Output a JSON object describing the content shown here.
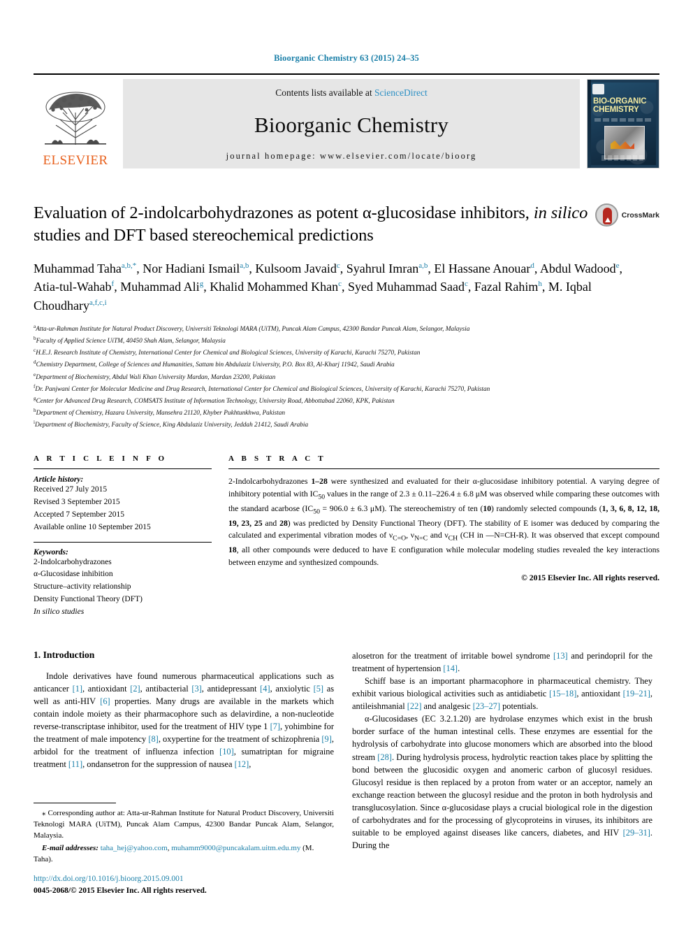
{
  "running_head": "Bioorganic Chemistry 63 (2015) 24–35",
  "masthead": {
    "contents_prefix": "Contents lists available at ",
    "sciencedirect": "ScienceDirect",
    "journal_name": "Bioorganic Chemistry",
    "homepage": "journal homepage: www.elsevier.com/locate/bioorg",
    "publisher_logo_text": "ELSEVIER",
    "cover": {
      "title_line1": "BIO-ORGANIC",
      "title_line2": "CHEMISTRY"
    },
    "accent_link_color": "#2b8fc4"
  },
  "title": {
    "part1": "Evaluation of 2-indolcarbohydrazones as potent α-glucosidase inhibitors, ",
    "italic": "in silico",
    "part2": " studies and DFT based stereochemical predictions"
  },
  "crossmark": {
    "label": "CrossMark"
  },
  "authors": [
    {
      "name": "Muhammad Taha",
      "sup": "a,b,*",
      "sep": ", "
    },
    {
      "name": "Nor Hadiani Ismail",
      "sup": "a,b",
      "sep": ", "
    },
    {
      "name": "Kulsoom Javaid",
      "sup": "c",
      "sep": ", "
    },
    {
      "name": "Syahrul Imran",
      "sup": "a,b",
      "sep": ", "
    },
    {
      "name": "El Hassane Anouar",
      "sup": "d",
      "sep": ", "
    },
    {
      "name": "Abdul Wadood",
      "sup": "e",
      "sep": ", "
    },
    {
      "name": "Atia-tul-Wahab",
      "sup": "f",
      "sep": ", "
    },
    {
      "name": "Muhammad Ali",
      "sup": "g",
      "sep": ", "
    },
    {
      "name": "Khalid Mohammed Khan",
      "sup": "c",
      "sep": ", "
    },
    {
      "name": "Syed Muhammad Saad",
      "sup": "c",
      "sep": ", "
    },
    {
      "name": "Fazal Rahim",
      "sup": "h",
      "sep": ", "
    },
    {
      "name": "M. Iqbal Choudhary",
      "sup": "a,f,c,i",
      "sep": ""
    }
  ],
  "affiliations": [
    {
      "mark": "a",
      "text": "Atta-ur-Rahman Institute for Natural Product Discovery, Universiti Teknologi MARA (UiTM), Puncak Alam Campus, 42300 Bandar Puncak Alam, Selangor, Malaysia"
    },
    {
      "mark": "b",
      "text": "Faculty of Applied Science UiTM, 40450 Shah Alam, Selangor, Malaysia"
    },
    {
      "mark": "c",
      "text": "H.E.J. Research Institute of Chemistry, International Center for Chemical and Biological Sciences, University of Karachi, Karachi 75270, Pakistan"
    },
    {
      "mark": "d",
      "text": "Chemistry Department, College of Sciences and Humanities, Sattam bin Abdulaziz University, P.O. Box 83, Al-Kharj 11942, Saudi Arabia"
    },
    {
      "mark": "e",
      "text": "Department of Biochemistry, Abdul Wali Khan University Mardan, Mardan 23200, Pakistan"
    },
    {
      "mark": "f",
      "text": "Dr. Panjwani Center for Molecular Medicine and Drug Research, International Center for Chemical and Biological Sciences, University of Karachi, Karachi 75270, Pakistan"
    },
    {
      "mark": "g",
      "text": "Center for Advanced Drug Research, COMSATS Institute of Information Technology, University Road, Abbottabad 22060, KPK, Pakistan"
    },
    {
      "mark": "h",
      "text": "Department of Chemistry, Hazara University, Mansehra 21120, Khyber Pukhtunkhwa, Pakistan"
    },
    {
      "mark": "i",
      "text": "Department of Biochemistry, Faculty of Science, King Abdulaziz University, Jeddah 21412, Saudi Arabia"
    }
  ],
  "article_info": {
    "heading": "A R T I C L E   I N F O",
    "history_label": "Article history:",
    "history": [
      "Received 27 July 2015",
      "Revised 3 September 2015",
      "Accepted 7 September 2015",
      "Available online 10 September 2015"
    ],
    "keywords_label": "Keywords:",
    "keywords": [
      "2-Indolcarbohydrazones",
      "α-Glucosidase inhibition",
      "Structure–activity relationship",
      "Density Functional Theory (DFT)",
      "In silico studies"
    ]
  },
  "abstract": {
    "heading": "A B S T R A C T",
    "s1": "2-Indolcarbohydrazones ",
    "b1": "1–28",
    "s2": " were synthesized and evaluated for their α-glucosidase inhibitory potential. A varying degree of inhibitory potential with IC",
    "sub1": "50",
    "s3": " values in the range of 2.3 ± 0.11–226.4 ± 6.8 μM was observed while comparing these outcomes with the standard acarbose (IC",
    "sub2": "50",
    "s4": " = 906.0 ± 6.3 μM). The stereochemistry of ten (",
    "b2": "10",
    "s5": ") randomly selected compounds (",
    "b3": "1, 3, 6, 8, 12, 18, 19, 23, 25",
    "s6": " and ",
    "b4": "28",
    "s7": ") was predicted by Density Functional Theory (DFT). The stability of E isomer was deduced by comparing the calculated and experimental vibration modes of ν",
    "sub3": "C=O",
    "s8": ", ν",
    "sub4": "N=C",
    "s9": " and ν",
    "sub5": "CH",
    "s10": " (CH in —N=CH-R). It was observed that except compound ",
    "b5": "18",
    "s11": ", all other compounds were deduced to have E configuration while molecular modeling studies revealed the key interactions between enzyme and synthesized compounds.",
    "copyright": "© 2015 Elsevier Inc. All rights reserved."
  },
  "body": {
    "section_heading": "1. Introduction",
    "left": {
      "p1_a": "Indole derivatives have found numerous pharmaceutical applications such as anticancer ",
      "r1": "[1]",
      "p1_b": ", antioxidant ",
      "r2": "[2]",
      "p1_c": ", antibacterial ",
      "r3": "[3]",
      "p1_d": ", antidepressant ",
      "r4": "[4]",
      "p1_e": ", anxiolytic ",
      "r5": "[5]",
      "p1_f": " as well as anti-HIV ",
      "r6": "[6]",
      "p1_g": " properties. Many drugs are available in the markets which contain indole moiety as their pharmacophore such as delavirdine, a non-nucleotide reverse-transcriptase inhibitor, used for the treatment of HIV type 1 ",
      "r7": "[7]",
      "p1_h": ", yohimbine for the treatment of male impotency ",
      "r8": "[8]",
      "p1_i": ", oxypertine for the treatment of schizophrenia ",
      "r9": "[9]",
      "p1_j": ", arbidol for the treatment of influenza infection ",
      "r10": "[10]",
      "p1_k": ", sumatriptan for migraine treatment ",
      "r11": "[11]",
      "p1_l": ", ondansetron for the suppression of nausea ",
      "r12": "[12]",
      "p1_m": ","
    },
    "right": {
      "p1_a": "alosetron for the treatment of irritable bowel syndrome ",
      "r13": "[13]",
      "p1_b": " and perindopril for the treatment of hypertension ",
      "r14": "[14]",
      "p1_c": ".",
      "p2_a": "Schiff base is an important pharmacophore in pharmaceutical chemistry. They exhibit various biological activities such as antidiabetic ",
      "r15": "[15–18]",
      "p2_b": ", antioxidant ",
      "r16": "[19–21]",
      "p2_c": ", antileishmanial ",
      "r17": "[22]",
      "p2_d": " and analgesic ",
      "r18": "[23–27]",
      "p2_e": " potentials.",
      "p3_a": "α-Glucosidases (EC 3.2.1.20) are hydrolase enzymes which exist in the brush border surface of the human intestinal cells. These enzymes are essential for the hydrolysis of carbohydrate into glucose monomers which are absorbed into the blood stream ",
      "r19": "[28]",
      "p3_b": ". During hydrolysis process, hydrolytic reaction takes place by splitting the bond between the glucosidic oxygen and anomeric carbon of glucosyl residues. Glucosyl residue is then replaced by a proton from water or an acceptor, namely an exchange reaction between the glucosyl residue and the proton in both hydrolysis and transglucosylation. Since α-glucosidase plays a crucial biological role in the digestion of carbohydrates and for the processing of glycoproteins in viruses, its inhibitors are suitable to be employed against diseases like cancers, diabetes, and HIV ",
      "r20": "[29–31]",
      "p3_c": ". During the"
    }
  },
  "footnote": {
    "star": "⁎ ",
    "text": "Corresponding author at: Atta-ur-Rahman Institute for Natural Product Discovery, Universiti Teknologi MARA (UiTM), Puncak Alam Campus, 42300 Bandar Puncak Alam, Selangor, Malaysia.",
    "email_label": "E-mail addresses:",
    "email1": "taha_hej@yahoo.com",
    "email_sep": ", ",
    "email2": "muhamm9000@puncakalam.uitm.edu.my",
    "email_attr": " (M. Taha)."
  },
  "doi_block": {
    "doi": "http://dx.doi.org/10.1016/j.bioorg.2015.09.001",
    "issn": "0045-2068/© 2015 Elsevier Inc. All rights reserved."
  }
}
